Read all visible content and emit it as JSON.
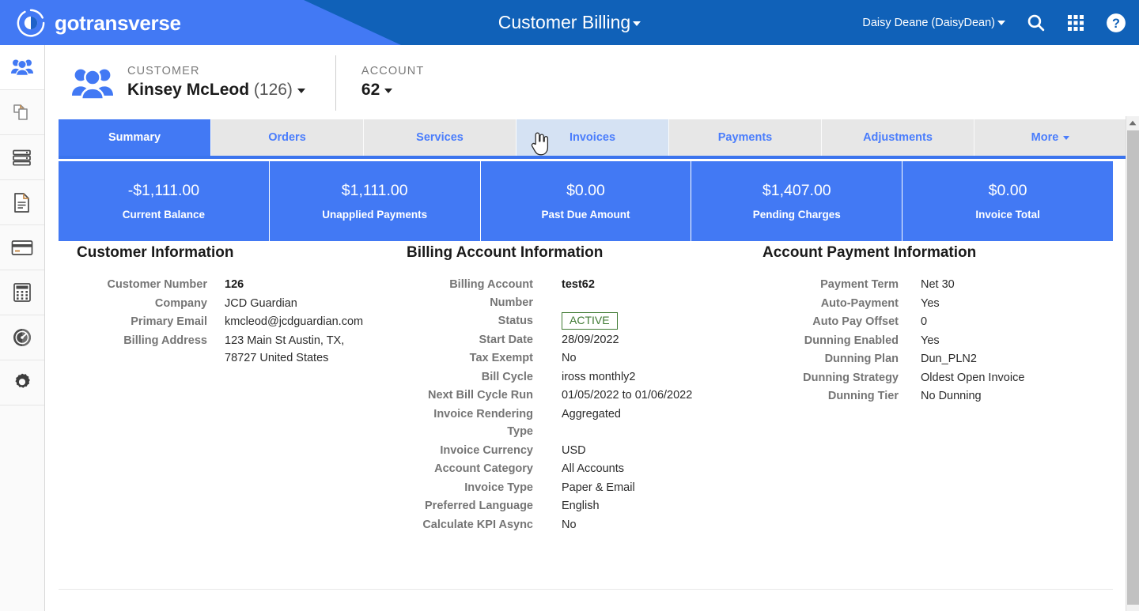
{
  "header": {
    "logo_text": "gotransverse",
    "logo_icon": "gotransverse-circle-logo-icon",
    "app_title": "Customer Billing",
    "user_label": "Daisy Deane (DaisyDean)",
    "icons": [
      "search-icon",
      "apps-grid-icon",
      "help-circle-icon"
    ],
    "brand_light": "#4279f4",
    "brand_dark": "#1061b8"
  },
  "sidebar": {
    "items": [
      {
        "name": "customers",
        "icon": "people-group-icon",
        "active": true
      },
      {
        "name": "orders",
        "icon": "copy-pages-icon",
        "active": false
      },
      {
        "name": "services",
        "icon": "server-stack-icon",
        "active": false
      },
      {
        "name": "invoices",
        "icon": "document-text-icon",
        "active": false
      },
      {
        "name": "payments",
        "icon": "credit-card-icon",
        "active": false
      },
      {
        "name": "adjustments",
        "icon": "calculator-icon",
        "active": false
      },
      {
        "name": "reports",
        "icon": "gauge-dashboard-icon",
        "active": false
      },
      {
        "name": "settings",
        "icon": "gear-icon",
        "active": false
      }
    ]
  },
  "context": {
    "customer_kicker": "CUSTOMER",
    "customer_name": "Kinsey McLeod",
    "customer_number_paren": "(126)",
    "account_kicker": "ACCOUNT",
    "account_value": "62",
    "avatar_icon": "people-group-icon"
  },
  "tabs": [
    {
      "label": "Summary",
      "state": "active"
    },
    {
      "label": "Orders",
      "state": "normal"
    },
    {
      "label": "Services",
      "state": "normal"
    },
    {
      "label": "Invoices",
      "state": "hover"
    },
    {
      "label": "Payments",
      "state": "normal"
    },
    {
      "label": "Adjustments",
      "state": "normal"
    },
    {
      "label": "More",
      "state": "normal",
      "caret": true
    }
  ],
  "kpis": [
    {
      "value": "-$1,111.00",
      "label": "Current Balance"
    },
    {
      "value": "$1,111.00",
      "label": "Unapplied Payments"
    },
    {
      "value": "$0.00",
      "label": "Past Due Amount"
    },
    {
      "value": "$1,407.00",
      "label": "Pending Charges"
    },
    {
      "value": "$0.00",
      "label": "Invoice Total"
    }
  ],
  "panels": {
    "customer_information": {
      "title": "Customer Information",
      "rows": [
        {
          "label": "Customer Number",
          "value": "126",
          "bold": true
        },
        {
          "label": "Company",
          "value": "JCD Guardian"
        },
        {
          "label": "Primary Email",
          "value": "kmcleod@jcdguardian.com"
        },
        {
          "label": "Billing Address",
          "value": "123 Main St Austin, TX,\n78727 United States"
        }
      ]
    },
    "billing_account_information": {
      "title": "Billing Account Information",
      "rows": [
        {
          "label": "Billing Account Number",
          "value": "test62",
          "bold": true
        },
        {
          "label": "Status",
          "value": "ACTIVE",
          "badge": true
        },
        {
          "label": "Start Date",
          "value": "28/09/2022"
        },
        {
          "label": "Tax Exempt",
          "value": "No"
        },
        {
          "label": "Bill Cycle",
          "value": "iross monthly2"
        },
        {
          "label": "Next Bill Cycle Run",
          "value": "01/05/2022 to 01/06/2022"
        },
        {
          "label": "Invoice Rendering Type",
          "value": "Aggregated"
        },
        {
          "label": "Invoice Currency",
          "value": "USD"
        },
        {
          "label": "Account Category",
          "value": "All Accounts"
        },
        {
          "label": "Invoice Type",
          "value": "Paper & Email"
        },
        {
          "label": "Preferred Language",
          "value": "English"
        },
        {
          "label": "Calculate KPI Async",
          "value": "No"
        }
      ]
    },
    "account_payment_information": {
      "title": "Account Payment Information",
      "rows": [
        {
          "label": "Payment Term",
          "value": "Net 30"
        },
        {
          "label": "Auto-Payment",
          "value": "Yes"
        },
        {
          "label": "Auto Pay Offset",
          "value": "0"
        },
        {
          "label": "Dunning Enabled",
          "value": "Yes"
        },
        {
          "label": "Dunning Plan",
          "value": "Dun_PLN2"
        },
        {
          "label": "Dunning Strategy",
          "value": "Oldest Open Invoice"
        },
        {
          "label": "Dunning Tier",
          "value": "No Dunning"
        }
      ]
    }
  },
  "scrollbar": {
    "up_icon": "triangle-up-icon"
  },
  "cursor": {
    "icon": "pointing-hand-cursor"
  },
  "status_badge_color": "#3f7a33"
}
